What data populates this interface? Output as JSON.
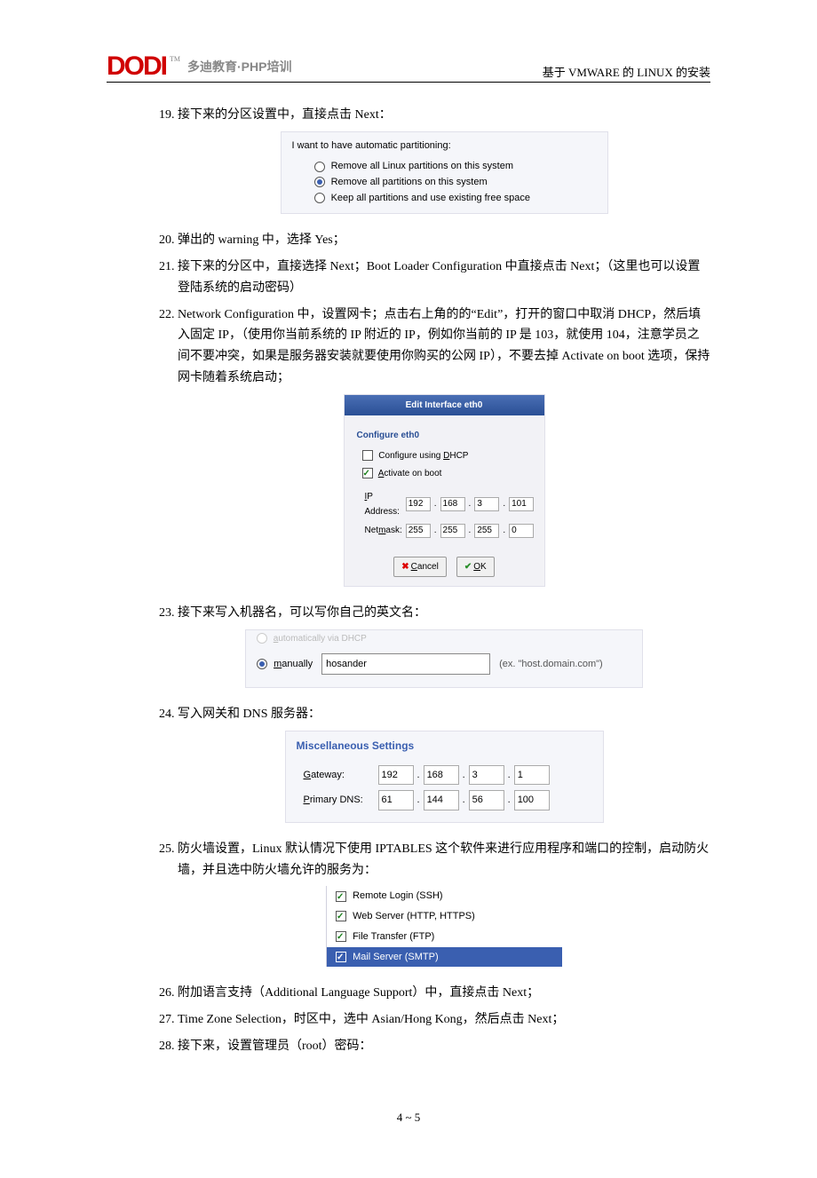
{
  "header": {
    "logo_text": "DODI",
    "logo_tm": "TM",
    "logo_tag": "多迪教育·PHP培训",
    "right_text": "基于 VMWARE 的 LINUX 的安装"
  },
  "items": {
    "19": "接下来的分区设置中，直接点击 Next：",
    "20": "弹出的 warning 中，选择 Yes；",
    "21": "接下来的分区中，直接选择 Next；Boot Loader Configuration 中直接点击 Next；（这里也可以设置登陆系统的启动密码）",
    "22": "Network Configuration 中，设置网卡；点击右上角的的“Edit”，打开的窗口中取消 DHCP，然后填入固定 IP，（使用你当前系统的 IP 附近的 IP，例如你当前的 IP 是 103，就使用 104，注意学员之间不要冲突，如果是服务器安装就要使用你购买的公网 IP），不要去掉 Activate on boot 选项，保持网卡随着系统启动；",
    "23": "接下来写入机器名，可以写你自己的英文名：",
    "24": "写入网关和 DNS 服务器：",
    "25": "防火墙设置，Linux 默认情况下使用 IPTABLES 这个软件来进行应用程序和端口的控制，启动防火墙，并且选中防火墙允许的服务为：",
    "26": "附加语言支持（Additional Language Support）中，直接点击 Next；",
    "27": "Time Zone Selection，时区中，选中 Asian/Hong Kong，然后点击 Next；",
    "28": "接下来，设置管理员（root）密码："
  },
  "ss1": {
    "title": "I want to have automatic partitioning:",
    "opt1": "Remove all Linux partitions on this system",
    "opt2": "Remove all partitions on this system",
    "opt3": "Keep all partitions and use existing free space"
  },
  "ss2": {
    "titlebar": "Edit Interface eth0",
    "sub": "Configure eth0",
    "dhcp_label": "Configure using DHCP",
    "activate_label": "Activate on boot",
    "ip_label": "IP Address:",
    "nm_label": "Netmask:",
    "ip": [
      "192",
      "168",
      "3",
      "101"
    ],
    "nm": [
      "255",
      "255",
      "255",
      "0"
    ],
    "cancel": "Cancel",
    "ok": "OK"
  },
  "ss3": {
    "cut_label": "automatically via DHCP",
    "radio_label": "manually",
    "value": "hosander",
    "hint": "(ex. \"host.domain.com\")"
  },
  "ss4": {
    "title": "Miscellaneous Settings",
    "gw_label": "Gateway:",
    "dns_label": "Primary DNS:",
    "gw": [
      "192",
      "168",
      "3",
      "1"
    ],
    "dns": [
      "61",
      "144",
      "56",
      "100"
    ]
  },
  "ss5": {
    "s1": "Remote Login (SSH)",
    "s2": "Web Server (HTTP, HTTPS)",
    "s3": "File Transfer (FTP)",
    "s4": "Mail Server (SMTP)"
  },
  "footer": "4 ~ 5"
}
